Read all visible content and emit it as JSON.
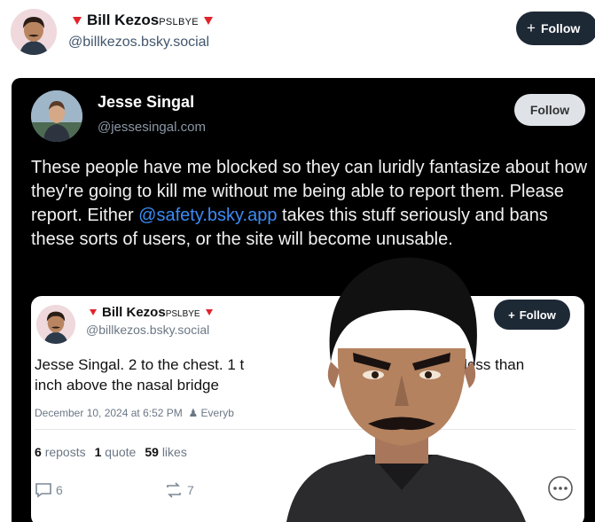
{
  "outer_post": {
    "name": "Bill Kezos",
    "name_suffix": "PSLBYE",
    "handle": "@billkezos.bsky.social",
    "follow_label": "Follow"
  },
  "embedded_post": {
    "name": "Jesse Singal",
    "handle": "@jessesingal.com",
    "follow_label": "Follow",
    "text_before": "These people have me blocked so they can luridly fantasize about how they're going to kill me without me being able to report them. Please report. Either ",
    "mention": "@safety.bsky.app",
    "text_after": " takes this stuff seriously and bans these sorts of users, or the site will become unusable."
  },
  "quoted_post": {
    "name": "Bill Kezos",
    "name_suffix": "PSLBYE",
    "handle": "@billkezos.bsky.social",
    "follow_label": "Follow",
    "text": "Jesse Singal. 2 to the chest. 1 t",
    "text_right": "e less than",
    "text_line2": "inch above the nasal bridge",
    "date": "December 10, 2024 at 6:52 PM",
    "audience": "Everyb",
    "reposts_count": "6",
    "reposts_label": "reposts",
    "quotes_count": "1",
    "quotes_label": "quote",
    "likes_count": "59",
    "likes_label": "likes",
    "reply_count": "6",
    "repost_count": "7"
  },
  "colors": {
    "mention": "#3b8cf6",
    "indicator": "#e0242c",
    "follow_dark": "#1e2936"
  }
}
